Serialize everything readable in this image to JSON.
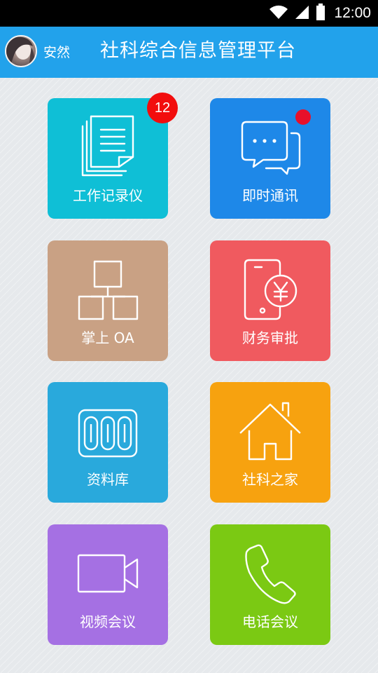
{
  "status_bar": {
    "time": "12:00",
    "icons": [
      "wifi-icon",
      "signal-icon",
      "battery-icon"
    ]
  },
  "header": {
    "user_name": "安然",
    "title": "社科综合信息管理平台",
    "background_color": "#22a2eb"
  },
  "tiles": [
    {
      "label": "工作记录仪",
      "icon": "document-icon",
      "color": "#0fbfd6",
      "badge": "12"
    },
    {
      "label": "即时通讯",
      "icon": "chat-bubbles-icon",
      "color": "#1e88e8",
      "dot": true
    },
    {
      "label": "掌上 OA",
      "icon": "org-chart-icon",
      "color": "#c9a184"
    },
    {
      "label": "财务审批",
      "icon": "phone-yen-icon",
      "color": "#f05a5f"
    },
    {
      "label": "资料库",
      "icon": "storage-icon",
      "color": "#29a9dc"
    },
    {
      "label": "社科之家",
      "icon": "house-icon",
      "color": "#f7a20f"
    },
    {
      "label": "视频会议",
      "icon": "video-camera-icon",
      "color": "#a570e3"
    },
    {
      "label": "电话会议",
      "icon": "phone-handset-icon",
      "color": "#7bc913"
    }
  ]
}
